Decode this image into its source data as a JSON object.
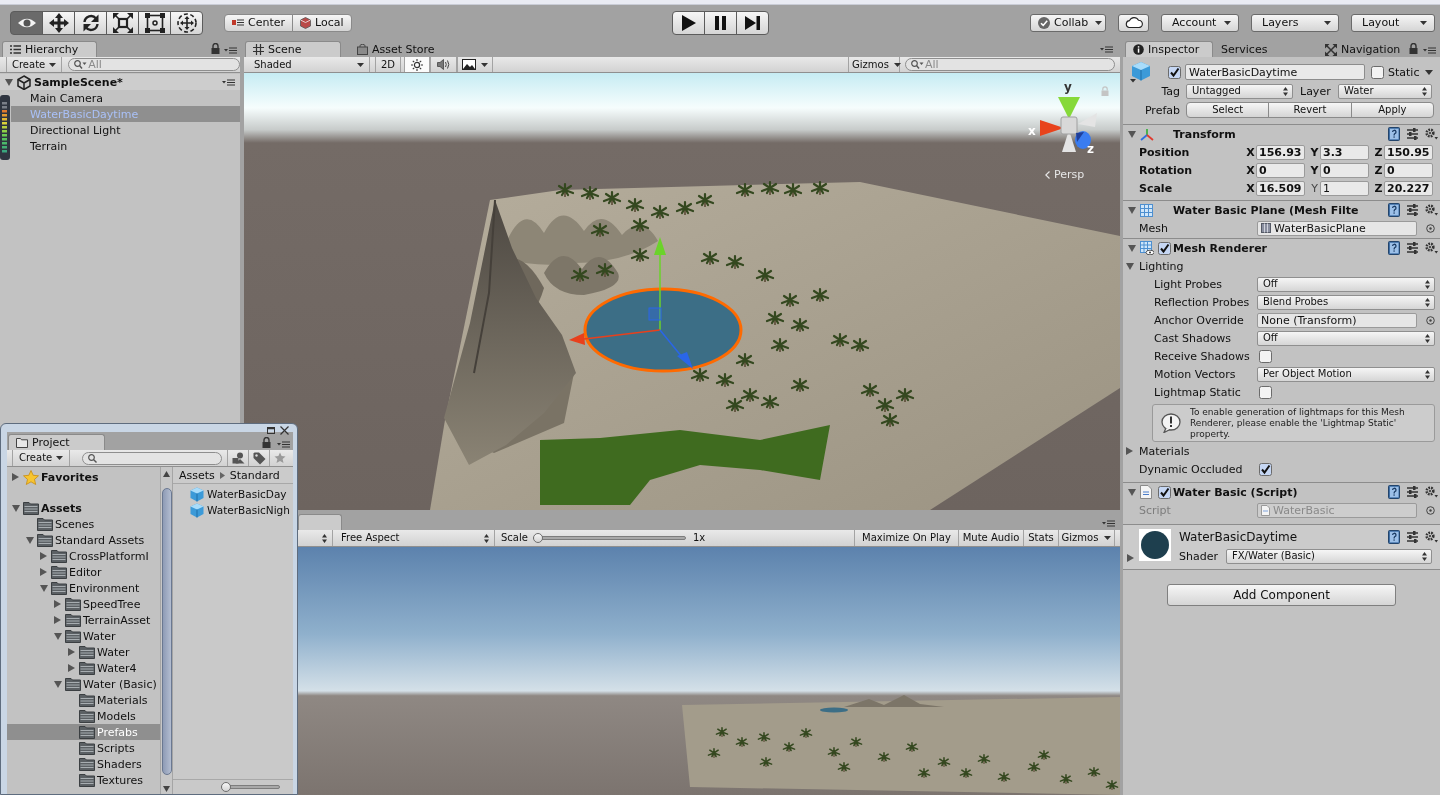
{
  "toolbar": {
    "tools": [
      {
        "kind": "view",
        "selected": true
      },
      {
        "kind": "move",
        "selected": false
      },
      {
        "kind": "rotate",
        "selected": false
      },
      {
        "kind": "scale",
        "selected": false
      },
      {
        "kind": "rect",
        "selected": false
      },
      {
        "kind": "transform",
        "selected": false
      }
    ],
    "handle_buttons": [
      {
        "kind": "pivot",
        "label": "Center"
      },
      {
        "kind": "space",
        "label": "Local"
      }
    ],
    "play_controls": [
      {
        "kind": "play"
      },
      {
        "kind": "pause"
      },
      {
        "kind": "step"
      }
    ],
    "right_buttons": [
      {
        "kind": "collab",
        "label": "Collab"
      },
      {
        "kind": "cloud"
      },
      {
        "kind": "dropdown",
        "label": "Account"
      },
      {
        "kind": "dropdown",
        "label": "Layers"
      },
      {
        "kind": "dropdown",
        "label": "Layout"
      }
    ]
  },
  "hierarchy": {
    "tab": "Hierarchy",
    "create": "Create",
    "search": {
      "placeholder": "All"
    },
    "scene": {
      "label": "SampleScene*",
      "expanded": true,
      "children": [
        {
          "label": "Main Camera",
          "selected": false
        },
        {
          "label": "WaterBasicDaytime",
          "selected": true
        },
        {
          "label": "Directional Light",
          "selected": false
        },
        {
          "label": "Terrain",
          "selected": false
        }
      ]
    }
  },
  "scene_view": {
    "tabs": [
      {
        "kind": "scene",
        "label": "Scene",
        "selected": true
      },
      {
        "kind": "store",
        "label": "Asset Store",
        "selected": false
      }
    ],
    "toolbar": {
      "draw_mode": "Shaded",
      "toggles": [
        {
          "kind": "mode",
          "label": "2D",
          "on": false
        },
        {
          "kind": "lighting",
          "on": true
        },
        {
          "kind": "audio",
          "on": false
        },
        {
          "kind": "effects",
          "on": false
        }
      ],
      "gizmos": "Gizmos",
      "search": {
        "placeholder": "All"
      }
    },
    "orientation_gizmo": {
      "x_label": "x",
      "y_label": "y",
      "z_label": "z",
      "projection": "Persp"
    }
  },
  "game_view": {
    "tab": {
      "selected": true
    },
    "toolbar": {
      "aspect": "Free Aspect",
      "scale_label": "Scale",
      "scale": {
        "level": 0
      },
      "scale_value": "1x",
      "buttons": [
        {
          "kind": "toggle",
          "label": "Maximize On Play",
          "on": false
        },
        {
          "kind": "toggle",
          "label": "Mute Audio",
          "on": false
        },
        {
          "kind": "toggle",
          "label": "Stats",
          "on": false
        },
        {
          "kind": "dropdown",
          "label": "Gizmos"
        }
      ]
    }
  },
  "project": {
    "tab": "Project",
    "create": "Create",
    "tree": [
      {
        "kind": "favorites",
        "label": "Favorites",
        "expanded": false,
        "selected": false
      },
      {
        "kind": "root",
        "label": "Assets",
        "expanded": true,
        "selected": false,
        "children": [
          {
            "kind": "folder",
            "label": "Scenes",
            "selected": false
          },
          {
            "kind": "folder",
            "label": "Standard Assets",
            "expanded": true,
            "selected": false,
            "children": [
              {
                "kind": "folder",
                "label": "CrossPlatformI",
                "expanded": false,
                "selected": false
              },
              {
                "kind": "folder",
                "label": "Editor",
                "expanded": false,
                "selected": false
              },
              {
                "kind": "folder",
                "label": "Environment",
                "expanded": true,
                "selected": false,
                "children": [
                  {
                    "kind": "folder",
                    "label": "SpeedTree",
                    "expanded": false,
                    "selected": false
                  },
                  {
                    "kind": "folder",
                    "label": "TerrainAsset",
                    "expanded": false,
                    "selected": false
                  },
                  {
                    "kind": "folder",
                    "label": "Water",
                    "expanded": true,
                    "selected": false,
                    "children": [
                      {
                        "kind": "folder",
                        "label": "Water",
                        "expanded": false,
                        "selected": false
                      },
                      {
                        "kind": "folder",
                        "label": "Water4",
                        "expanded": false,
                        "selected": false
                      }
                    ]
                  },
                  {
                    "kind": "folder",
                    "label": "Water (Basic)",
                    "expanded": true,
                    "selected": false,
                    "children": [
                      {
                        "kind": "folder",
                        "label": "Materials",
                        "selected": false
                      },
                      {
                        "kind": "folder",
                        "label": "Models",
                        "selected": false
                      },
                      {
                        "kind": "folder",
                        "label": "Prefabs",
                        "selected": true
                      },
                      {
                        "kind": "folder",
                        "label": "Scripts",
                        "selected": false
                      },
                      {
                        "kind": "folder",
                        "label": "Shaders",
                        "selected": false
                      },
                      {
                        "kind": "folder",
                        "label": "Textures",
                        "selected": false
                      }
                    ]
                  }
                ]
              }
            ]
          }
        ]
      }
    ],
    "breadcrumb": [
      "Assets",
      "Standard"
    ],
    "items": [
      {
        "label": "WaterBasicDay",
        "selected": false
      },
      {
        "label": "WaterBasicNigh",
        "selected": false
      }
    ],
    "size_slider": {
      "level": 0
    }
  },
  "inspector": {
    "tabs": [
      {
        "kind": "info",
        "label": "Inspector",
        "selected": true
      },
      {
        "kind": "plain",
        "label": "Services",
        "selected": false
      },
      {
        "kind": "navigation",
        "label": "Navigation",
        "selected": false
      }
    ],
    "object": {
      "active": true,
      "name": "WaterBasicDaytime",
      "static_label": "Static",
      "static": false,
      "tag_label": "Tag",
      "tag": "Untagged",
      "layer_label": "Layer",
      "layer": "Water",
      "prefab_label": "Prefab",
      "prefab_buttons": [
        "Select",
        "Revert",
        "Apply"
      ]
    },
    "components": [
      {
        "kind": "transform",
        "title": "Transform",
        "expanded": true,
        "rows": [
          {
            "label": "Position",
            "overridden": true,
            "axes": [
              {
                "axis": "X",
                "value": "156.93",
                "overridden": true
              },
              {
                "axis": "Y",
                "value": "3.3",
                "overridden": true
              },
              {
                "axis": "Z",
                "value": "150.95",
                "overridden": true
              }
            ]
          },
          {
            "label": "Rotation",
            "overridden": true,
            "axes": [
              {
                "axis": "X",
                "value": "0",
                "overridden": true
              },
              {
                "axis": "Y",
                "value": "0",
                "overridden": true
              },
              {
                "axis": "Z",
                "value": "0",
                "overridden": true
              }
            ]
          },
          {
            "label": "Scale",
            "overridden": true,
            "axes": [
              {
                "axis": "X",
                "value": "16.509",
                "overridden": true
              },
              {
                "axis": "Y",
                "value": "1",
                "overridden": false
              },
              {
                "axis": "Z",
                "value": "20.227",
                "overridden": true
              }
            ]
          }
        ]
      },
      {
        "kind": "mesh_filter",
        "title": "Water Basic Plane (Mesh Filte",
        "expanded": true,
        "properties": [
          {
            "kind": "mesh",
            "label": "Mesh",
            "value": "WaterBasicPlane"
          }
        ]
      },
      {
        "kind": "mesh_renderer",
        "title": "Mesh Renderer",
        "enabled": true,
        "expanded": true,
        "properties": [
          {
            "kind": "foldout",
            "label": "Lighting",
            "expanded": true,
            "children": [
              {
                "kind": "dropdown",
                "label": "Light Probes",
                "value": "Off"
              },
              {
                "kind": "dropdown",
                "label": "Reflection Probes",
                "value": "Blend Probes"
              },
              {
                "kind": "object",
                "label": "Anchor Override",
                "value": "None (Transform)"
              },
              {
                "kind": "dropdown",
                "label": "Cast Shadows",
                "value": "Off"
              },
              {
                "kind": "checkbox",
                "label": "Receive Shadows",
                "checked": false
              },
              {
                "kind": "dropdown",
                "label": "Motion Vectors",
                "value": "Per Object Motion"
              },
              {
                "kind": "checkbox",
                "label": "Lightmap Static",
                "checked": false
              },
              {
                "kind": "help",
                "text": "To enable generation of lightmaps for this Mesh Renderer, please enable the 'Lightmap Static' property."
              }
            ]
          },
          {
            "kind": "foldout",
            "label": "Materials",
            "expanded": false
          },
          {
            "kind": "checkbox",
            "label": "Dynamic Occluded",
            "checked": true
          }
        ]
      },
      {
        "kind": "script",
        "title": "Water Basic (Script)",
        "enabled": true,
        "expanded": true,
        "properties": [
          {
            "kind": "script",
            "label": "Script",
            "value": "WaterBasic",
            "disabled": true
          }
        ]
      }
    ],
    "material": {
      "name": "WaterBasicDaytime",
      "expanded": false,
      "shader_label": "Shader",
      "shader": "FX/Water (Basic)"
    },
    "add_component": "Add Component"
  }
}
